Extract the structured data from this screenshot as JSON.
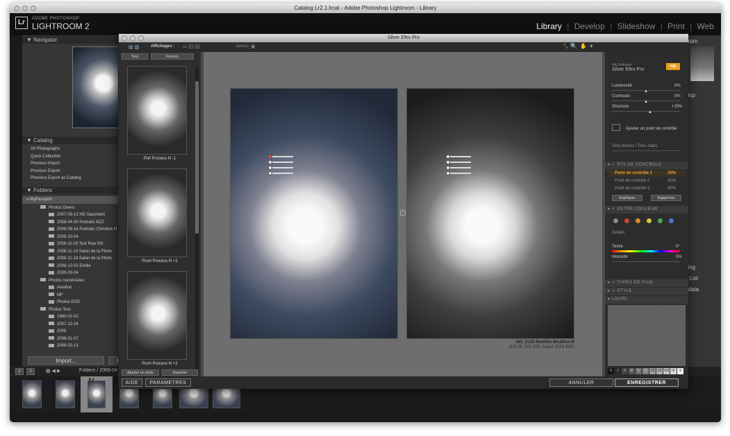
{
  "window": {
    "title": "Catalog Lr2.1.lrcat - Adobe Photoshop Lightroom - Library"
  },
  "lightroom": {
    "badge": "Lr",
    "adobe": "ADOBE PHOTOSHOP",
    "product": "LIGHTROOM 2",
    "modules": [
      "Library",
      "Develop",
      "Slideshow",
      "Print",
      "Web"
    ],
    "active_module": "Library",
    "panels": {
      "navigator": "Navigator",
      "catalog": "Catalog",
      "folders": "Folders"
    },
    "catalog_items": [
      "All Photographs",
      "Quick Collection",
      "Previous Import",
      "Previous Export",
      "Previous Export as Catalog"
    ],
    "volume": "MyPassport",
    "folders": [
      "Photos Divers",
      "2007-09-13 HD Sausheim",
      "2008-04-30 Portraits BZZ",
      "2008-09-16 Portraits Christine H",
      "2008-10-04",
      "2008-11-03 Test Raw G9",
      "2008-11-13 Salon de la Photo",
      "2008-11-14 Salon de la Photo",
      "2008-12-02 Emilie",
      "2009-03-04",
      "Photos numérisées",
      "Aviation",
      "MF",
      "Photos EOD",
      "Photos Test",
      "1980-01-01",
      "2007-12-24",
      "2008",
      "2008-01-07",
      "2008-02-13"
    ],
    "import_button": "Import...",
    "export_partial": "Ex",
    "filmstrip_path": "Folders / 2009-04-",
    "page_1": "1",
    "page_2": "2",
    "right_partial": [
      "gram",
      "elop",
      "ding",
      "d List",
      "adata"
    ],
    "selected_thumb_number": "3"
  },
  "silver_efex": {
    "title": "Silver Efex Pro",
    "toolbar": {
      "affichages": "Affichages :",
      "apercu": "Aperçu"
    },
    "preset_tabs": [
      "Tout",
      "Favoris"
    ],
    "presets": [
      "Pull Process N -1",
      "Push Process N +1",
      "Push Process N +2"
    ],
    "ajouter_style": "Ajouter un style",
    "importer": "Importer",
    "filename": "_MG_0135-Modifier-Modifier.tif",
    "exif": "(1/5 f/8, ISO 200, Canon EOS 50D)",
    "brand_line1": "Nik Software",
    "brand_line2": "Silver Efex Pro",
    "brand_badge": "nik",
    "luminosite": "Luminosité",
    "luminosite_val": "0%",
    "contraste": "Contraste",
    "contraste_val": "0%",
    "structure": "Structure",
    "structure_val": "+15%",
    "add_point": "Ajouter un point de contrôle",
    "tons": "Tons foncés / Tons clairs",
    "pts_header": "PTS DE CONTROLE",
    "points": [
      {
        "label": "Point de contrôle 1",
        "value": "30%"
      },
      {
        "label": "Point de contrôle 2",
        "value": "30%"
      },
      {
        "label": "Point de contrôle 3",
        "value": "30%"
      }
    ],
    "dupliquer": "Dupliquer",
    "supprimer": "Supprimer",
    "filtre_header": "FILTRE COULEUR",
    "details": "Détails",
    "teinte": "Teinte",
    "teinte_val": "0°",
    "intensite": "Intensité",
    "intensite_val": "0%",
    "types_film": "TYPES DE FILM",
    "style": "STYLE",
    "loupe": "LOUPE",
    "zone_labels": [
      "0",
      "I",
      "II",
      "III",
      "IV",
      "V",
      "VI",
      "VII",
      "VIII",
      "IX",
      "X"
    ],
    "filter_colors": [
      "#8a8a8a",
      "#d0403a",
      "#e08a2a",
      "#d8c83a",
      "#4aa84a",
      "#4a7ad0"
    ],
    "aide": "AIDE",
    "parametres": "PARAMETRES",
    "annuler": "ANNULER",
    "enregistrer": "ENREGISTRER"
  }
}
